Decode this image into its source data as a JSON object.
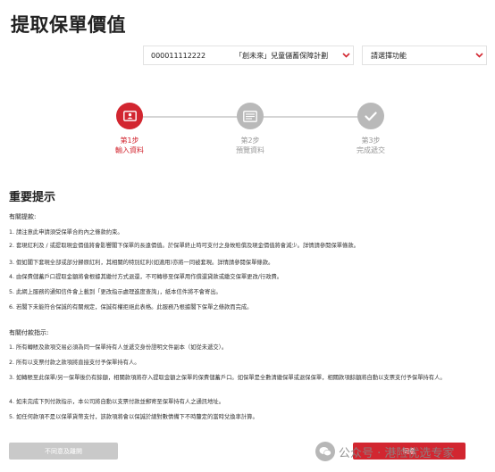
{
  "page_title": "提取保單價值",
  "policy_select": {
    "policy_number": "000011112222",
    "plan_name": "「創未來」兒童儲蓄保障計劃",
    "icon": "chevron-down-icon"
  },
  "function_select": {
    "placeholder": "請選擇功能",
    "icon": "chevron-down-icon"
  },
  "steps": [
    {
      "number": "第1步",
      "label": "輸入資料",
      "state": "active",
      "icon": "id-card-icon"
    },
    {
      "number": "第2步",
      "label": "預覽資料",
      "state": "inactive",
      "icon": "form-preview-icon"
    },
    {
      "number": "第3步",
      "label": "完成遞交",
      "state": "inactive",
      "icon": "check-icon"
    }
  ],
  "important_notice": {
    "heading": "重要提示",
    "withdrawal": {
      "title": "有關提款:",
      "items": [
        "1. 請注意此申請須受保單合約內之條款約束。",
        "2. 套現紅利及 / 或提取現金價值將會影響閣下保單的長遠價值。於保單終止時可支付之身故賠償及現金價值將會減少。詳情請參閱保單條款。",
        "3. 假如閣下套現全部或部分歸原紅利，其相關的特別紅利(如適用)亦將一同被套現。詳情請參閱保單條款。",
        "4. 由保費儲蓄戶口提取金額將會根據其繳付方式退還，不可轉移至保單用作償還貸款或繳交保單更改/行政費。",
        "5. 此網上服務的通知信件會上載到「更改指示處理進度查詢」，紙本信件將不會寄出。",
        "6. 若閣下未能符合保誠的有關規定，保誠有權拒絕此表格。此服務乃根據閣下保單之條款而完成。"
      ]
    },
    "payment": {
      "title": "有關付款指示:",
      "items": [
        "1. 所有轉賬及款項交易必須為同一保單持有人並遞交身份證明文件副本（如從未遞交）。",
        "2. 所有以支票付款之款項將直接支付予保單持有人。",
        "3. 如轉賬至此保單/另一保單後仍有餘額，相關款項將存入提取金額之保單的保費儲蓄戶口。如保單是全數清繳保單或退保保單，相關款項餘額將自動以支票支付予保單持有人。",
        "4. 如未完成下列付款指示，本公司將自動以支票付款並郵寄至保單持有人之通訊地址。",
        "5. 如任何款項不是以保單貨幣支付，該款項將會以保誠於總對數情備下不時釐定的當時兌換率計算。"
      ]
    }
  },
  "buttons": {
    "disagree": "不同意及離開",
    "agree": "同意"
  },
  "watermark": {
    "text": "公众号 · 港险优选专家",
    "icon": "wechat-icon"
  },
  "colors": {
    "accent": "#d22630",
    "inactive": "#b9b9b9",
    "disabled_button": "#c9c9c9"
  }
}
